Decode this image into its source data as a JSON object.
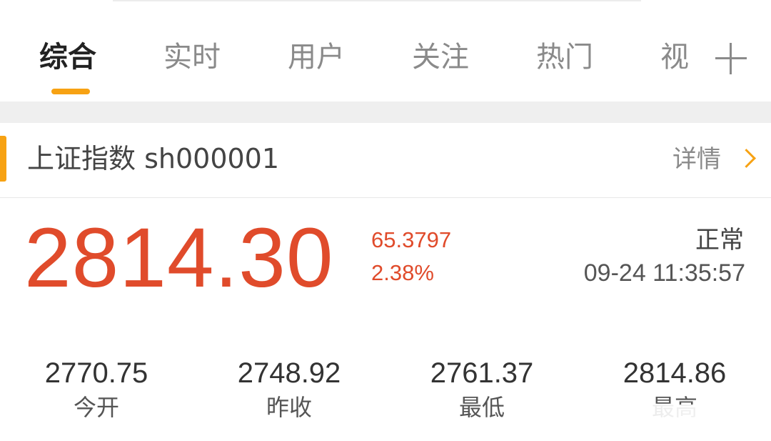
{
  "tabs": [
    {
      "label": "综合",
      "active": true
    },
    {
      "label": "实时",
      "active": false
    },
    {
      "label": "用户",
      "active": false
    },
    {
      "label": "关注",
      "active": false
    },
    {
      "label": "热门",
      "active": false
    },
    {
      "label": "视",
      "active": false
    }
  ],
  "tab_add_icon": "plus-icon",
  "stock": {
    "name": "上证指数 sh000001",
    "detail_label": "详情",
    "detail_icon": "chevron-right-icon",
    "price": "2814.30",
    "change": "65.3797",
    "change_percent": "2.38%",
    "status": "正常",
    "time": "09-24 11:35:57",
    "stats": [
      {
        "value": "2770.75",
        "label": "今开"
      },
      {
        "value": "2748.92",
        "label": "昨收"
      },
      {
        "value": "2761.37",
        "label": "最低"
      },
      {
        "value": "2814.86",
        "label": "最高"
      }
    ]
  },
  "colors": {
    "accent": "#f7a213",
    "up": "#e04b2b",
    "tab_active": "#222222",
    "tab_inactive": "#8a8a8a"
  }
}
